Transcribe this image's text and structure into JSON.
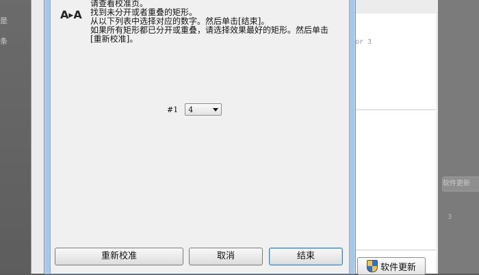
{
  "background": {
    "left_edge_texts": [
      "是",
      "条"
    ],
    "right_faint_text": "or 3",
    "right_side_button": "软件更新",
    "right_side_number": "3",
    "update_button_label": "软件更新"
  },
  "dialog": {
    "instructions": [
      "请查看校准页。",
      "找到未分开或者重叠的矩形。",
      "从以下列表中选择对应的数字。然后单击[结束]。",
      "如果所有矩形都已分开或重叠，请选择效果最好的矩形。然后单击",
      "[重新校准]。"
    ],
    "select_label": "#1",
    "select_value": "4",
    "buttons": {
      "recalibrate": "重新校准",
      "cancel": "取消",
      "finish": "结束"
    }
  }
}
